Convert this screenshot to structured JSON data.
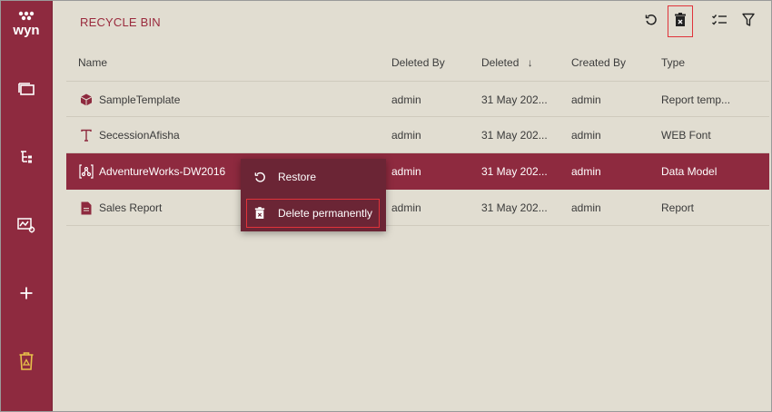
{
  "app": {
    "logo_text": "wyn"
  },
  "sidebar": {
    "items": [
      {
        "icon": "documents-icon"
      },
      {
        "icon": "hierarchy-icon"
      },
      {
        "icon": "monitor-icon"
      },
      {
        "icon": "plus-icon"
      },
      {
        "icon": "recycle-bin-icon",
        "active": true
      }
    ]
  },
  "header": {
    "title": "RECYCLE BIN"
  },
  "toolbar": {
    "refresh_icon": "refresh-icon",
    "empty_bin_icon": "empty-recycle-bin-icon",
    "columns_icon": "column-settings-icon",
    "filter_icon": "filter-icon"
  },
  "table": {
    "columns": [
      "Name",
      "Deleted By",
      "Deleted",
      "Created By",
      "Type"
    ],
    "sort_indicator": "↓",
    "rows": [
      {
        "icon": "report-template-icon",
        "name": "SampleTemplate",
        "deleted_by": "admin",
        "deleted": "31 May 202...",
        "created_by": "admin",
        "type": "Report temp..."
      },
      {
        "icon": "font-icon",
        "name": "SecessionAfisha",
        "deleted_by": "admin",
        "deleted": "31 May 202...",
        "created_by": "admin",
        "type": "WEB Font"
      },
      {
        "icon": "data-model-icon",
        "name": "AdventureWorks-DW2016",
        "deleted_by": "admin",
        "deleted": "31 May 202...",
        "created_by": "admin",
        "type": "Data Model",
        "selected": true
      },
      {
        "icon": "report-icon",
        "name": "Sales Report",
        "deleted_by": "admin",
        "deleted": "31 May 202...",
        "created_by": "admin",
        "type": "Report"
      }
    ]
  },
  "context_menu": {
    "items": [
      {
        "icon": "restore-icon",
        "label": "Restore"
      },
      {
        "icon": "delete-permanently-icon",
        "label": "Delete permanently"
      }
    ]
  },
  "colors": {
    "accent": "#8e2a3f",
    "background": "#e1ddd1",
    "highlight": "#e0333a",
    "active_icon": "#e8c14a"
  }
}
